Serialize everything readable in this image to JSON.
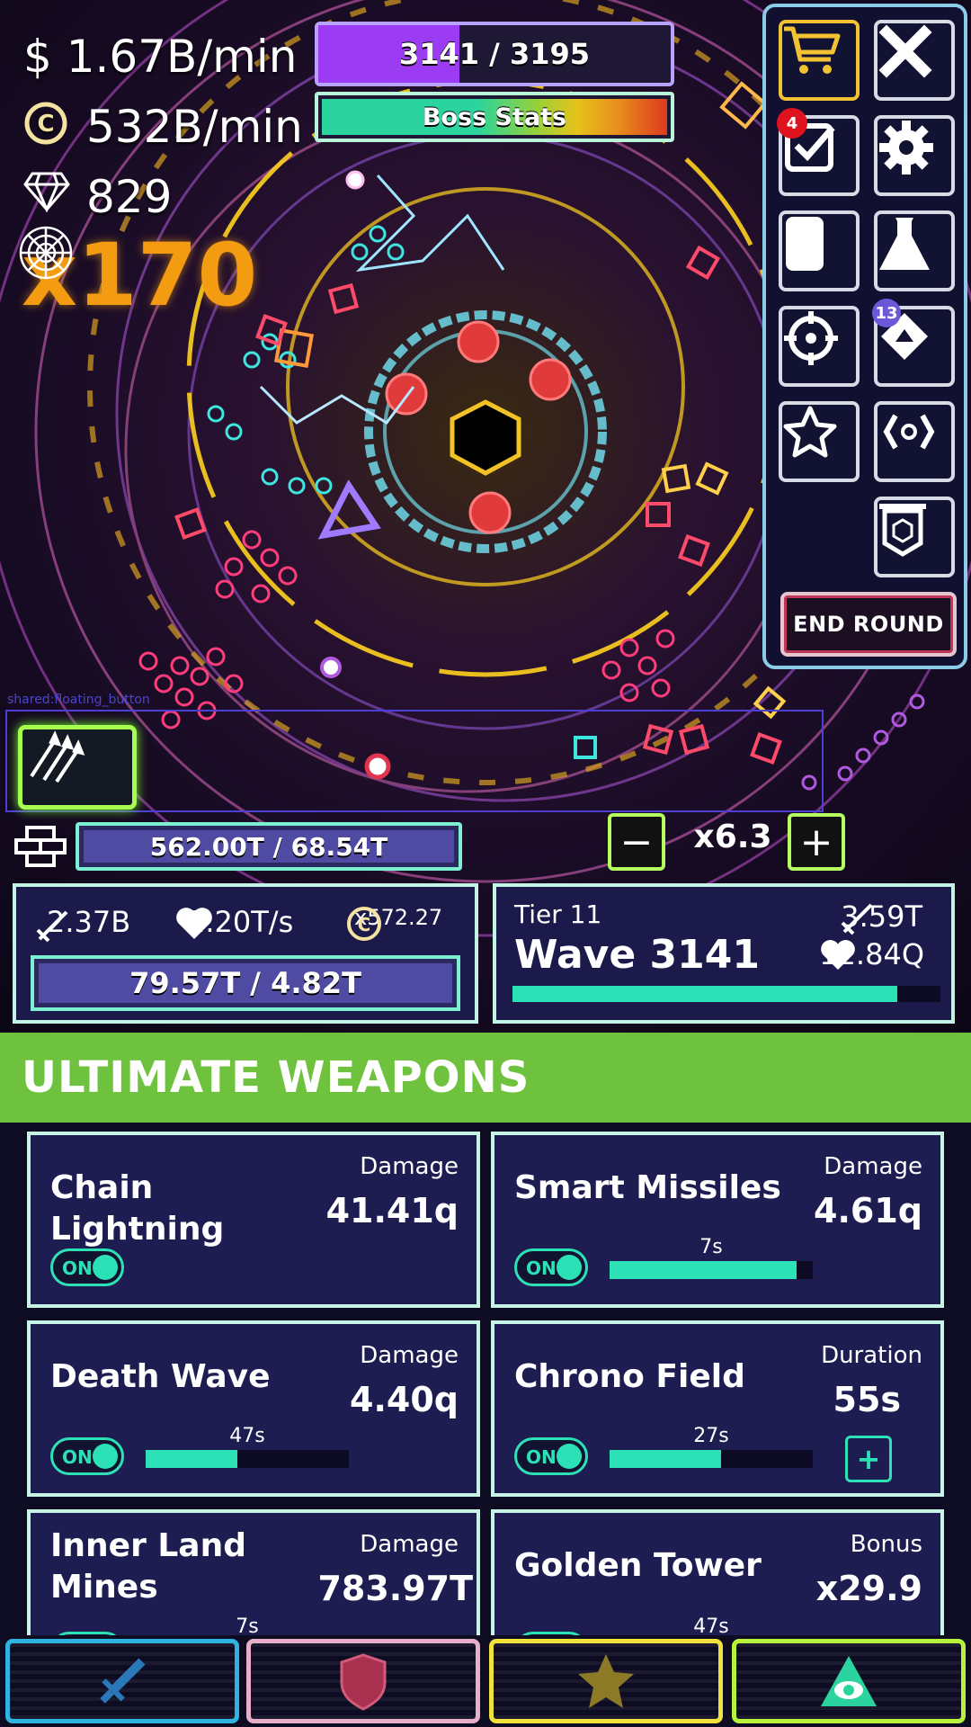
{
  "resources": {
    "money_rate": "$ 1.67B/min",
    "coin_rate": "532B/min",
    "gems": "829",
    "multiplier": "x170"
  },
  "wave_bar": {
    "text": "3141 / 3195",
    "fill_fraction": 0.4
  },
  "boss_bar": {
    "label": "Boss Stats"
  },
  "side_menu": {
    "items": [
      {
        "name": "shop",
        "icon": "cart-icon"
      },
      {
        "name": "close",
        "icon": "close-icon"
      },
      {
        "name": "missions",
        "icon": "checkbox-icon",
        "badge": "4"
      },
      {
        "name": "settings",
        "icon": "gear-icon"
      },
      {
        "name": "cards",
        "icon": "card-icon"
      },
      {
        "name": "labs",
        "icon": "flask-icon"
      },
      {
        "name": "target",
        "icon": "crosshair-icon"
      },
      {
        "name": "modules",
        "icon": "diamond-icon",
        "badge": "13"
      },
      {
        "name": "perks",
        "icon": "star-icon"
      },
      {
        "name": "sensor",
        "icon": "signal-icon"
      },
      {
        "name": "guild",
        "icon": "banner-icon"
      }
    ],
    "end_round": "END ROUND"
  },
  "floating_label": "shared:floating_button",
  "wall_bar": {
    "text": "562.00T / 68.54T"
  },
  "speed": {
    "value": "x6.3",
    "minus": "−",
    "plus": "+"
  },
  "player_card": {
    "damage": "2.37B",
    "regen": "2.20T/s",
    "coin_mult": "x572.27",
    "health": "79.57T / 4.82T"
  },
  "wave_card": {
    "tier": "Tier 11",
    "wave": "Wave 3141",
    "enemy_damage": "3.59T",
    "enemy_health": "12.84Q",
    "progress_fraction": 0.9
  },
  "ultimate_weapons": {
    "title": "ULTIMATE WEAPONS",
    "items": [
      {
        "name": "Chain Lightning",
        "stat_label": "Damage",
        "stat_value": "41.41q",
        "toggle": "ON"
      },
      {
        "name": "Smart Missiles",
        "stat_label": "Damage",
        "stat_value": "4.61q",
        "toggle": "ON",
        "timer": "7s",
        "timer_fraction": 0.92
      },
      {
        "name": "Death Wave",
        "stat_label": "Damage",
        "stat_value": "4.40q",
        "toggle": "ON",
        "timer": "47s",
        "timer_fraction": 0.45
      },
      {
        "name": "Chrono Field",
        "stat_label": "Duration",
        "stat_value": "55s",
        "toggle": "ON",
        "timer": "27s",
        "timer_fraction": 0.55,
        "plus": "+"
      },
      {
        "name": "Inner Land Mines",
        "stat_label": "Damage",
        "stat_value": "783.97T",
        "toggle": "ON",
        "timer": "7s"
      },
      {
        "name": "Golden Tower",
        "stat_label": "Bonus",
        "stat_value": "x29.9",
        "toggle": "ON",
        "timer": "47s"
      }
    ]
  },
  "bottom_nav": [
    {
      "name": "attack",
      "icon": "sword-icon",
      "color": "#2fb4e0"
    },
    {
      "name": "defense",
      "icon": "shield-icon",
      "color": "#e7b0c8"
    },
    {
      "name": "utility",
      "icon": "star-icon",
      "color": "#f0e23a"
    },
    {
      "name": "ultimate",
      "icon": "eye-triangle-icon",
      "color": "#b8f23a"
    }
  ]
}
